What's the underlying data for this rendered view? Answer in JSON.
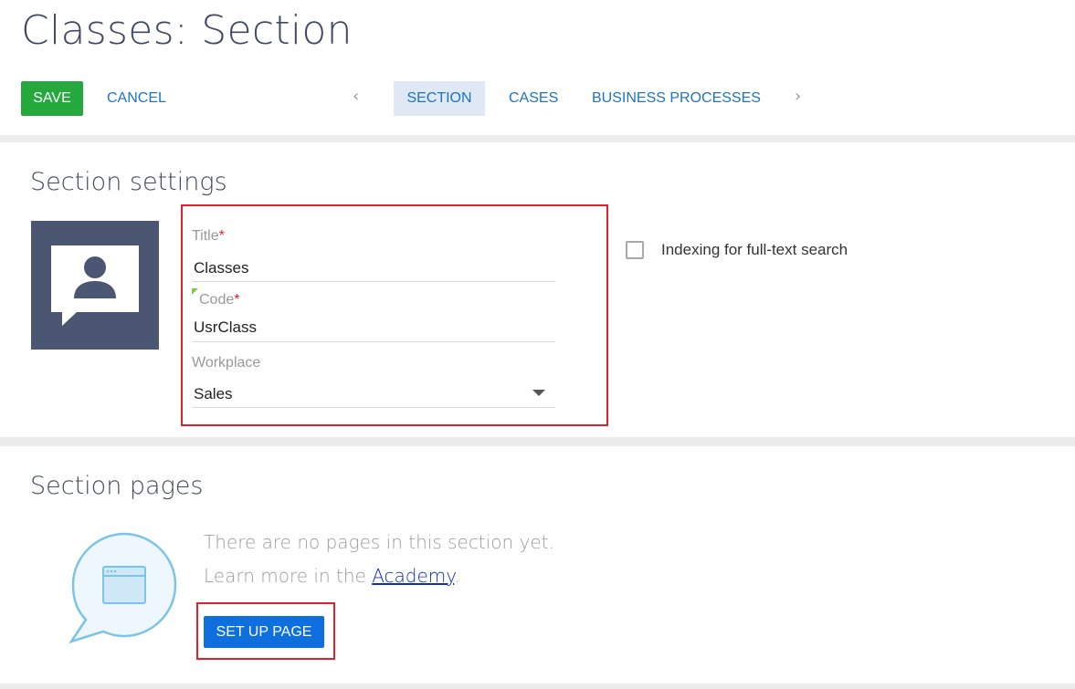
{
  "header": {
    "title": "Classes: Section",
    "save_label": "SAVE",
    "cancel_label": "CANCEL",
    "tabs": [
      {
        "label": "SECTION",
        "active": true
      },
      {
        "label": "CASES",
        "active": false
      },
      {
        "label": "BUSINESS PROCESSES",
        "active": false
      }
    ],
    "prev_icon": "chevron-left-icon",
    "next_icon": "chevron-right-icon"
  },
  "section_settings": {
    "heading": "Section settings",
    "icon": "person-speech-bubble-icon",
    "fields": {
      "title": {
        "label": "Title",
        "required_mark": "*",
        "value": "Classes"
      },
      "code": {
        "label": "Code",
        "required_mark": "*",
        "value": "UsrClass"
      },
      "workplace": {
        "label": "Workplace",
        "value": "Sales"
      }
    },
    "indexing": {
      "label": "Indexing for full-text search",
      "checked": false
    }
  },
  "section_pages": {
    "heading": "Section pages",
    "icon": "browser-window-speech-bubble-icon",
    "empty_message": "There are no pages in this section yet.",
    "learn_more_prefix": "Learn more in the ",
    "academy_link": "Academy",
    "learn_more_suffix": ".",
    "setup_button": "SET UP PAGE"
  },
  "colors": {
    "save": "#25a93d",
    "link": "#1b74c5",
    "primary_button": "#0f6fdf",
    "highlight": "#e0202f",
    "icon_tile": "#4b5772"
  }
}
